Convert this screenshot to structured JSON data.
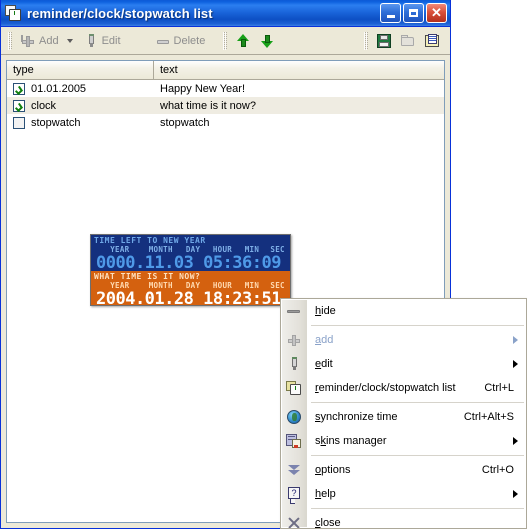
{
  "window": {
    "title": "reminder/clock/stopwatch list",
    "icon": "clock-list-icon",
    "caption_buttons": [
      {
        "name": "minimize",
        "glyph": "_"
      },
      {
        "name": "maximize",
        "glyph": "□"
      },
      {
        "name": "close",
        "glyph": "✕"
      }
    ]
  },
  "toolbar": {
    "add_label": "Add",
    "edit_label": "Edit",
    "delete_label": "Delete",
    "move_up": "move-up",
    "move_down": "move-down",
    "save": "save",
    "open": "open",
    "print": "print"
  },
  "list": {
    "columns": [
      "type",
      "text"
    ],
    "rows": [
      {
        "checked": true,
        "type": "01.01.2005",
        "text": "Happy New Year!",
        "selected": false
      },
      {
        "checked": true,
        "type": "clock",
        "text": "what time is it now?",
        "selected": true
      },
      {
        "checked": false,
        "type": "stopwatch",
        "text": "stopwatch",
        "selected": false
      }
    ]
  },
  "clock_widget": {
    "top": {
      "title": "TIME LEFT TO NEW YEAR",
      "labels": [
        "YEAR",
        "MONTH",
        "DAY",
        "HOUR",
        "MIN",
        "SEC"
      ],
      "digits": "0000.11.03 05:36:09",
      "bg": "#14307e",
      "fg": "#4f9ae8"
    },
    "bottom": {
      "title": "WHAT TIME IS IT NOW?",
      "labels": [
        "YEAR",
        "MONTH",
        "DAY",
        "HOUR",
        "MIN",
        "SEC"
      ],
      "digits": "2004.01.28 18:23:51",
      "bg": "#d4610f",
      "fg": "#ffffff"
    }
  },
  "context_menu": {
    "items": [
      {
        "icon": "minus-icon",
        "label": "hide",
        "accel": "",
        "submenu": false,
        "disabled": false,
        "sep_after": true
      },
      {
        "icon": "plus-icon",
        "label": "add",
        "accel": "",
        "submenu": true,
        "disabled": true,
        "sep_after": false
      },
      {
        "icon": "pencil-icon",
        "label": "edit",
        "accel": "",
        "submenu": true,
        "disabled": false,
        "sep_after": false
      },
      {
        "icon": "clock-list-icon",
        "label": "reminder/clock/stopwatch list",
        "accel": "Ctrl+L",
        "submenu": false,
        "disabled": false,
        "sep_after": true
      },
      {
        "icon": "globe-icon",
        "label": "synchronize time",
        "accel": "Ctrl+Alt+S",
        "submenu": false,
        "disabled": false,
        "sep_after": false
      },
      {
        "icon": "skins-icon",
        "label": "skins manager",
        "accel": "",
        "submenu": true,
        "disabled": false,
        "sep_after": true
      },
      {
        "icon": "chevrons-icon",
        "label": "options",
        "accel": "Ctrl+O",
        "submenu": false,
        "disabled": false,
        "sep_after": false
      },
      {
        "icon": "question-icon",
        "label": "help",
        "accel": "",
        "submenu": true,
        "disabled": false,
        "sep_after": true
      },
      {
        "icon": "close-x-icon",
        "label": "close",
        "accel": "",
        "submenu": false,
        "disabled": false,
        "sep_after": false
      }
    ]
  },
  "colors": {
    "title_blue": "#1862d8",
    "face": "#ece9d8",
    "selection": "#efece2",
    "clock_blue": "#14307e",
    "clock_orange": "#d4610f"
  }
}
